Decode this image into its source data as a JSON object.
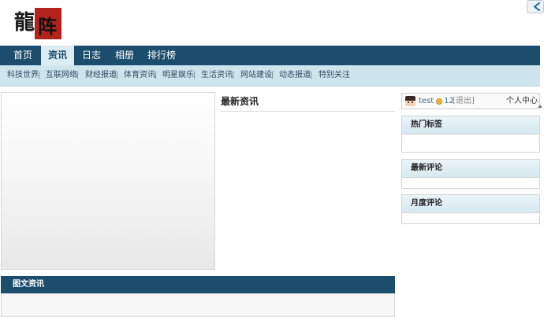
{
  "logo": {
    "char1": "龍",
    "char2": "阵"
  },
  "main_nav": [
    {
      "label": "首页",
      "active": false
    },
    {
      "label": "资讯",
      "active": true
    },
    {
      "label": "日志",
      "active": false
    },
    {
      "label": "相册",
      "active": false
    },
    {
      "label": "排行榜",
      "active": false
    }
  ],
  "sub_nav": [
    "科技世界",
    "互联网络",
    "财经报道",
    "体育资讯",
    "明星娱乐",
    "生活资讯",
    "网站建设",
    "动态报道",
    "特别关注"
  ],
  "sub_nav_separator": "|",
  "news": {
    "title": "最新资讯"
  },
  "picture_news": {
    "title": "图文资讯"
  },
  "user": {
    "name": "test",
    "credits": "12",
    "logout": "[退出]",
    "center": "个人中心"
  },
  "sidebar": {
    "hot_tags": "热门标签",
    "latest_comments": "最新评论",
    "monthly_comments": "月度评论"
  },
  "colors": {
    "nav_bg": "#1c4d6d",
    "nav_active_bg": "#dcecf3",
    "subnav_bg": "#cfe5ee",
    "logo_seal": "#b4231b"
  }
}
